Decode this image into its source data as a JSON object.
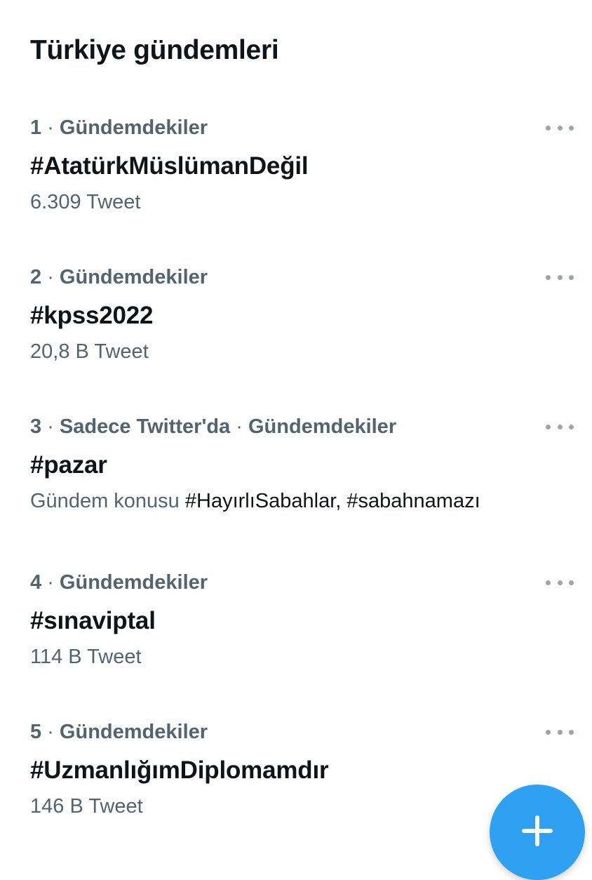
{
  "page": {
    "title": "Türkiye gündemleri"
  },
  "trends": [
    {
      "rank": "1",
      "context": "Gündemdekiler",
      "name": "#AtatürkMüslümanDeğil",
      "count": "6.309 Tweet"
    },
    {
      "rank": "2",
      "context": "Gündemdekiler",
      "name": "#kpss2022",
      "count": "20,8 B Tweet"
    },
    {
      "rank": "3",
      "source": "Sadece Twitter'da",
      "context": "Gündemdekiler",
      "name": "#pazar",
      "related_label": "Gündem konusu",
      "related_tags": "#HayırlıSabahlar, #sabahnamazı"
    },
    {
      "rank": "4",
      "context": "Gündemdekiler",
      "name": "#sınaviptal",
      "count": "114 B Tweet"
    },
    {
      "rank": "5",
      "context": "Gündemdekiler",
      "name": "#UzmanlığımDiplomamdır",
      "count": "146 B Tweet"
    }
  ],
  "separator": " · ",
  "icons": {
    "more": "more-horizontal-icon",
    "compose": "plus-icon"
  },
  "colors": {
    "text_primary": "#0f1419",
    "text_secondary": "#536471",
    "accent": "#2ea1f2"
  }
}
